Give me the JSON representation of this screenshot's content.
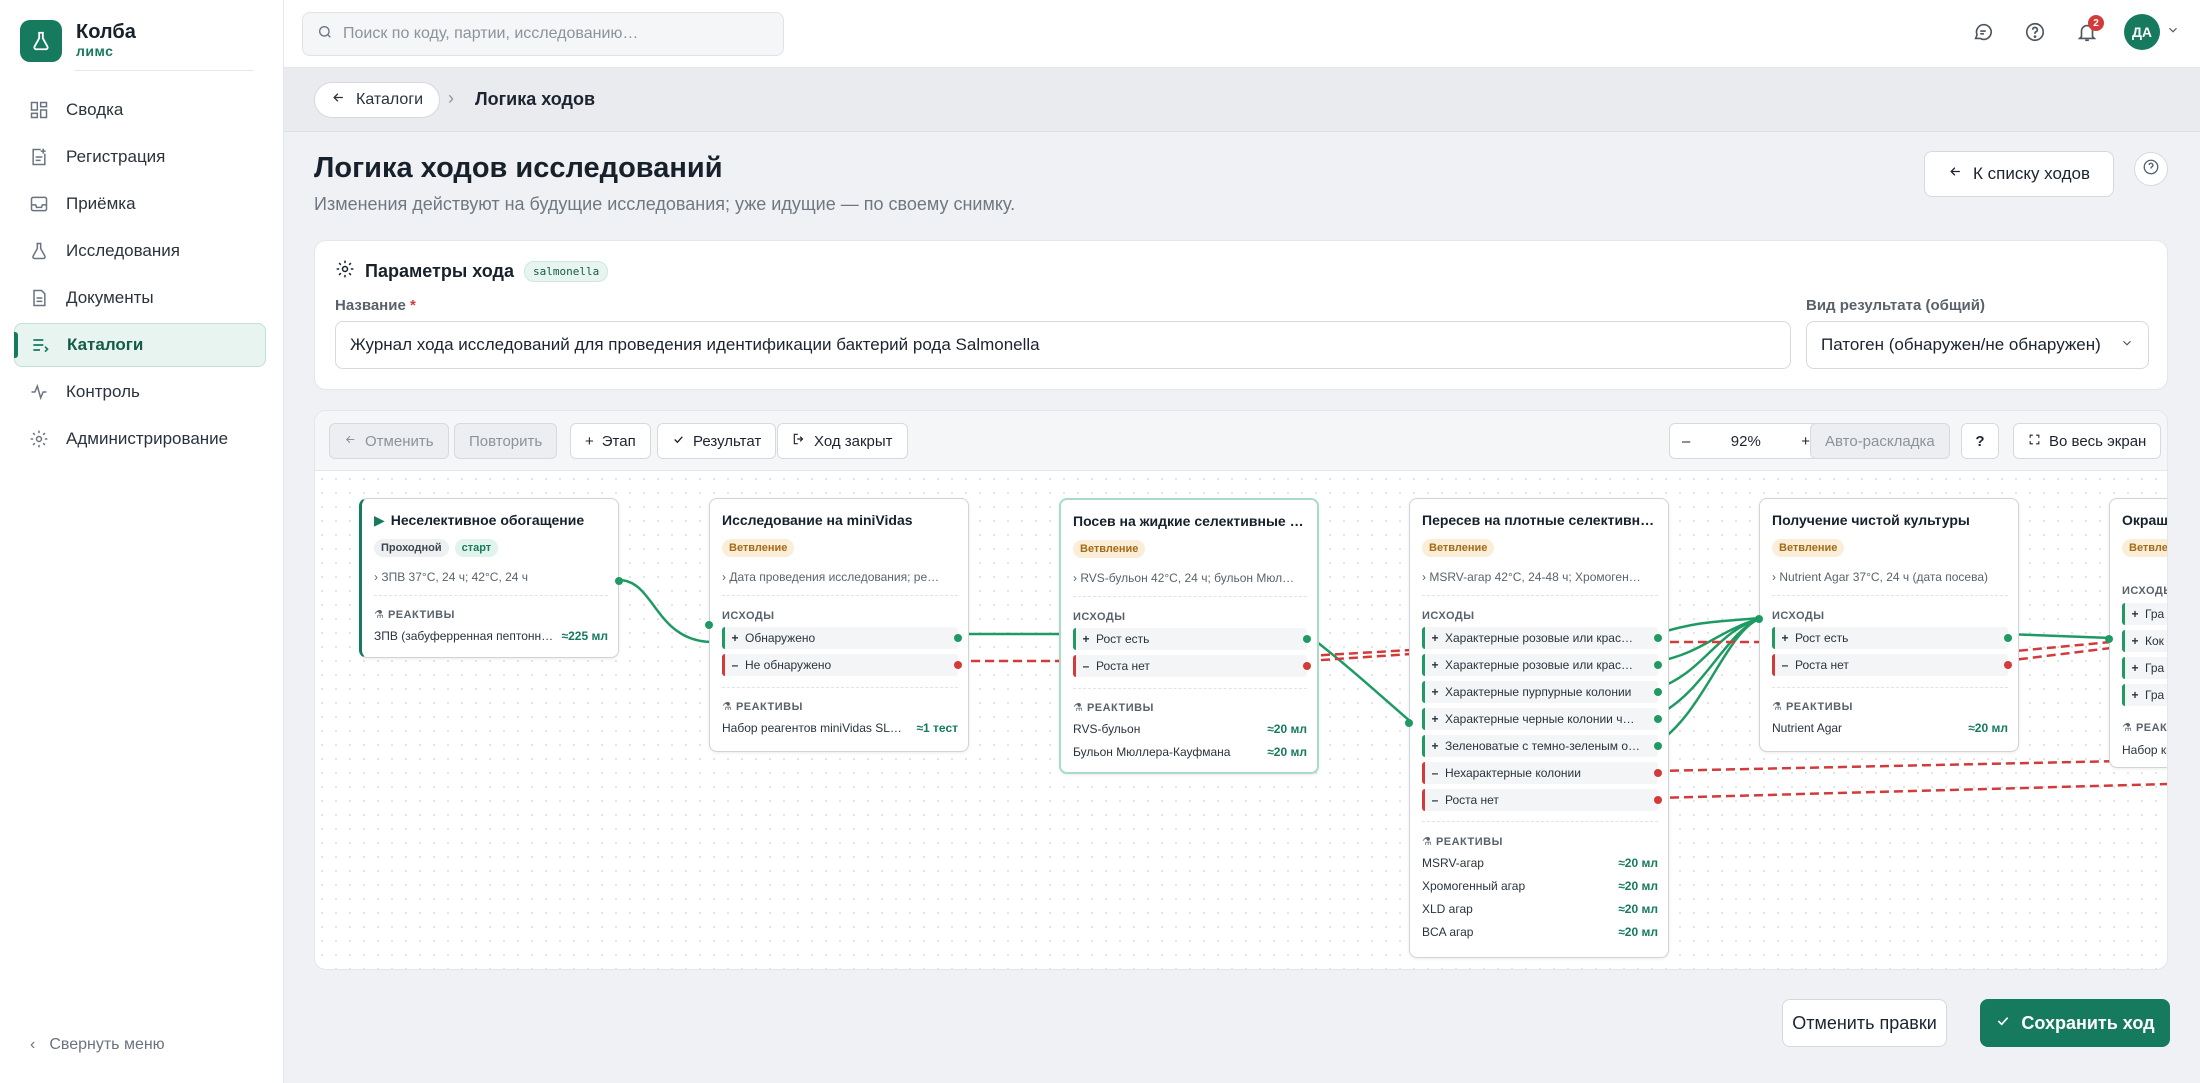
{
  "brand": {
    "name": "Колба",
    "sub": "лимс"
  },
  "sidebar": {
    "items": [
      {
        "label": "Сводка",
        "icon": "dashboard-icon"
      },
      {
        "label": "Регистрация",
        "icon": "register-icon"
      },
      {
        "label": "Приёмка",
        "icon": "inbox-icon"
      },
      {
        "label": "Исследования",
        "icon": "flask-icon"
      },
      {
        "label": "Документы",
        "icon": "document-icon"
      },
      {
        "label": "Каталоги",
        "icon": "catalog-icon",
        "active": true
      },
      {
        "label": "Контроль",
        "icon": "pulse-icon"
      },
      {
        "label": "Администрирование",
        "icon": "gear-icon"
      }
    ],
    "collapse_label": "Свернуть меню"
  },
  "topbar": {
    "search_placeholder": "Поиск по коду, партии, исследованию…",
    "notifications_count": "2",
    "avatar_initials": "ДА"
  },
  "breadcrumb": {
    "back_label": "Каталоги",
    "current": "Логика ходов"
  },
  "page": {
    "title": "Логика ходов исследований",
    "subtitle": "Изменения действуют на будущие исследования; уже идущие — по своему снимку.",
    "back_to_list": "К списку ходов"
  },
  "params": {
    "heading": "Параметры хода",
    "code": "salmonella",
    "name_label": "Название",
    "name_required": "*",
    "name_value": "Журнал хода исследований для проведения идентификации бактерий рода Salmonella",
    "result_type_label": "Вид результата (общий)",
    "result_type_value": "Патоген (обнаружен/не обнаружен)"
  },
  "toolbar": {
    "undo": "Отменить",
    "redo": "Повторить",
    "add_stage": "Этап",
    "add_result": "Результат",
    "close_flow": "Ход закрыт",
    "zoom_out": "–",
    "zoom_level": "92%",
    "zoom_in": "+",
    "auto_layout": "Авто-раскладка",
    "help": "?",
    "fullscreen": "Во весь экран"
  },
  "labels": {
    "outcomes": "ИСХОДЫ",
    "reagents": "РЕАКТИВЫ"
  },
  "nodes": [
    {
      "title": "Неселективное обогащение",
      "tags": [
        "Проходной",
        "старт"
      ],
      "condition": "ЗПВ 37°C, 24 ч; 42°C, 24 ч",
      "outcomes": [],
      "reagents": [
        {
          "name": "ЗПВ (забуферренная пептонна…",
          "qty": "≈225 мл"
        }
      ]
    },
    {
      "title": "Исследование на miniVidas",
      "tags": [
        "Ветвление"
      ],
      "condition": "Дата проведения исследования; ре…",
      "outcomes": [
        {
          "sign": "+",
          "text": "Обнаружено"
        },
        {
          "sign": "–",
          "text": "Не обнаружено"
        }
      ],
      "reagents": [
        {
          "name": "Набор реагентов miniVidas SL…",
          "qty": "≈1 тест"
        }
      ]
    },
    {
      "title": "Посев на жидкие селективные …",
      "tags": [
        "Ветвление"
      ],
      "condition": "RVS-бульон 42°C, 24 ч; бульон Мюл…",
      "outcomes": [
        {
          "sign": "+",
          "text": "Рост есть"
        },
        {
          "sign": "–",
          "text": "Роста нет"
        }
      ],
      "reagents": [
        {
          "name": "RVS-бульон",
          "qty": "≈20 мл"
        },
        {
          "name": "Бульон Мюллера-Кауфмана",
          "qty": "≈20 мл"
        }
      ]
    },
    {
      "title": "Пересев на плотные селективн…",
      "tags": [
        "Ветвление"
      ],
      "condition": "MSRV-агар 42°C, 24-48 ч; Хромоген…",
      "outcomes": [
        {
          "sign": "+",
          "text": "Характерные розовые или крас…"
        },
        {
          "sign": "+",
          "text": "Характерные розовые или крас…"
        },
        {
          "sign": "+",
          "text": "Характерные пурпурные колонии"
        },
        {
          "sign": "+",
          "text": "Характерные черные колонии ч…"
        },
        {
          "sign": "+",
          "text": "Зеленоватые с темно-зеленым о…"
        },
        {
          "sign": "–",
          "text": "Нехарактерные колонии"
        },
        {
          "sign": "–",
          "text": "Роста нет"
        }
      ],
      "reagents": [
        {
          "name": "MSRV-агар",
          "qty": "≈20 мл"
        },
        {
          "name": "Хромогенный агар",
          "qty": "≈20 мл"
        },
        {
          "name": "XLD агар",
          "qty": "≈20 мл"
        },
        {
          "name": "BCA агар",
          "qty": "≈20 мл"
        }
      ]
    },
    {
      "title": "Получение чистой культуры",
      "tags": [
        "Ветвление"
      ],
      "condition": "Nutrient Agar 37°C, 24 ч (дата посева)",
      "outcomes": [
        {
          "sign": "+",
          "text": "Рост есть"
        },
        {
          "sign": "–",
          "text": "Роста нет"
        }
      ],
      "reagents": [
        {
          "name": "Nutrient Agar",
          "qty": "≈20 мл"
        }
      ]
    },
    {
      "title": "Окраш",
      "tags": [
        "Ветвле"
      ],
      "outcomes": [
        {
          "sign": "+",
          "text": "Гра"
        },
        {
          "sign": "+",
          "text": "Кок"
        },
        {
          "sign": "+",
          "text": "Гра"
        },
        {
          "sign": "+",
          "text": "Гра"
        }
      ],
      "reagents": [
        {
          "name": "Набор кр",
          "qty": ""
        }
      ],
      "reagents_label": "РЕАК"
    }
  ],
  "footer": {
    "cancel": "Отменить правки",
    "save": "Сохранить ход"
  },
  "colors": {
    "accent": "#167a5f",
    "positive": "#1f9a63",
    "negative": "#d33a3a",
    "branch": "#a46a16"
  }
}
